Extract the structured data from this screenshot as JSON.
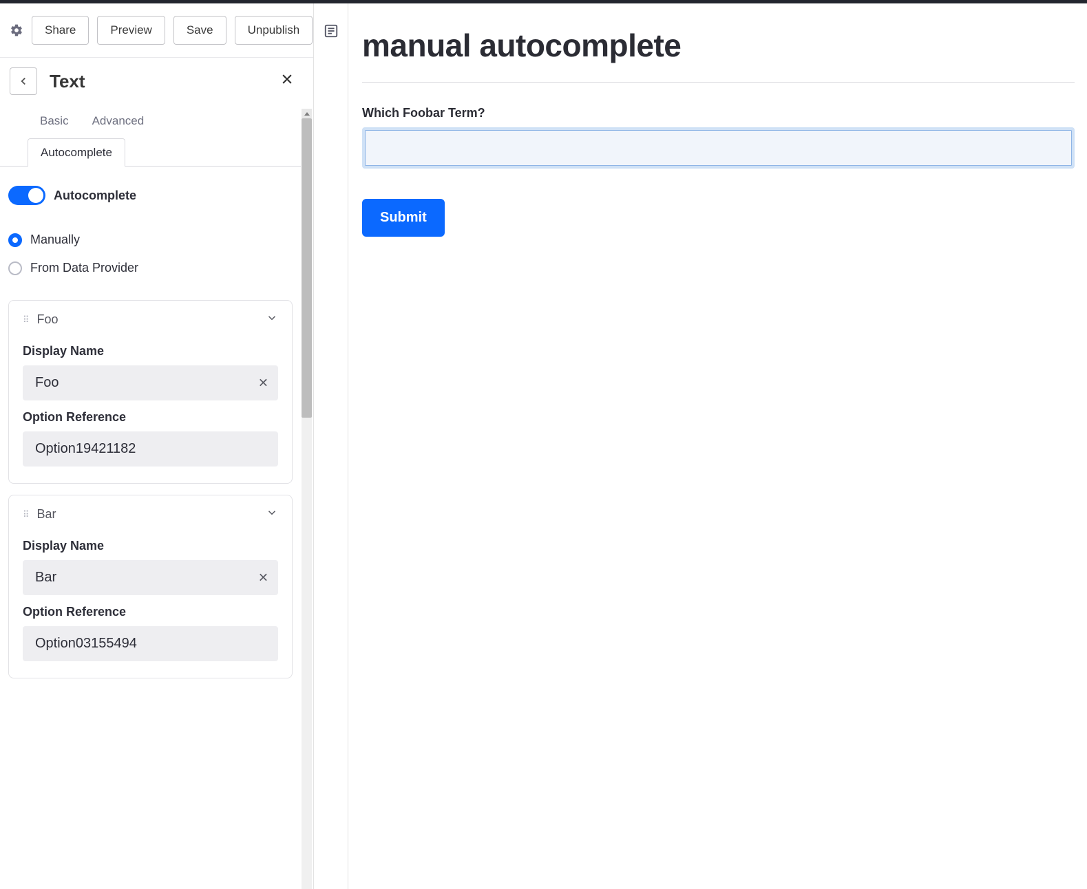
{
  "toolbar": {
    "share": "Share",
    "preview": "Preview",
    "save": "Save",
    "unpublish": "Unpublish"
  },
  "panel": {
    "title": "Text"
  },
  "tabs": {
    "basic": "Basic",
    "advanced": "Advanced",
    "autocomplete": "Autocomplete"
  },
  "autocomplete": {
    "toggle_label": "Autocomplete",
    "source": {
      "manual": "Manually",
      "provider": "From Data Provider"
    }
  },
  "labels": {
    "display_name": "Display Name",
    "option_reference": "Option Reference"
  },
  "options": [
    {
      "title": "Foo",
      "display_name": "Foo",
      "reference": "Option19421182"
    },
    {
      "title": "Bar",
      "display_name": "Bar",
      "reference": "Option03155494"
    }
  ],
  "preview": {
    "heading": "manual autocomplete",
    "question": "Which Foobar Term?",
    "submit": "Submit"
  }
}
